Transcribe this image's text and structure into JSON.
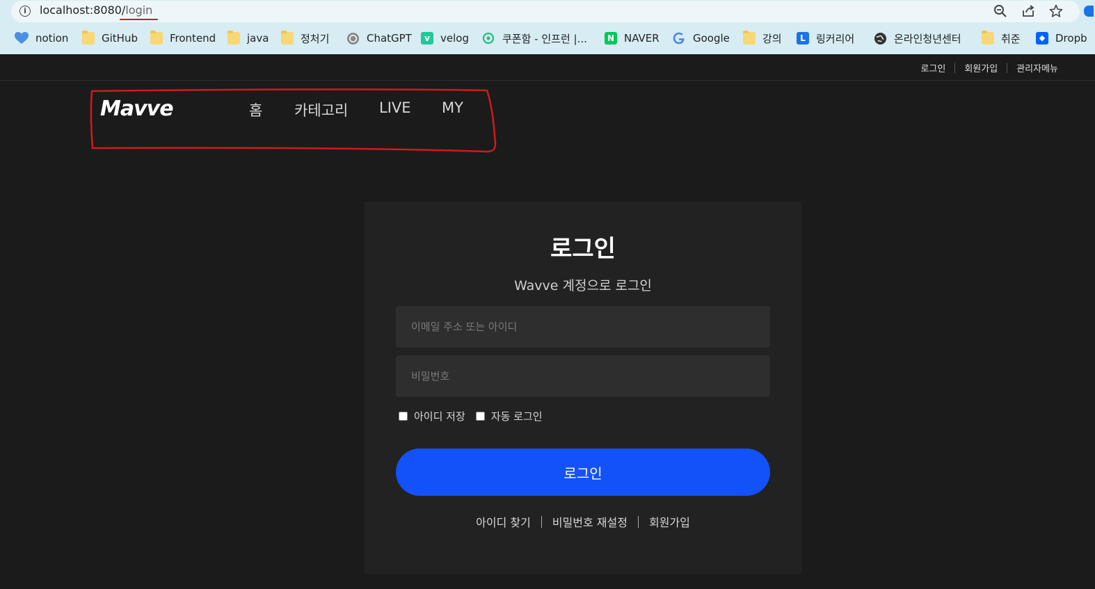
{
  "browser": {
    "url_host": "localhost:8080/",
    "url_path": "login",
    "bookmarks": [
      {
        "label": "notion",
        "icon": "heart-icon",
        "color": "#3d8fe0"
      },
      {
        "label": "GitHub",
        "icon": "folder-icon"
      },
      {
        "label": "Frontend",
        "icon": "folder-icon"
      },
      {
        "label": "java",
        "icon": "folder-icon"
      },
      {
        "label": "정처기",
        "icon": "folder-icon"
      },
      {
        "label": "ChatGPT",
        "icon": "chatgpt-icon"
      },
      {
        "label": "velog",
        "icon": "velog-icon",
        "color": "#20c997"
      },
      {
        "label": "쿠폰함 - 인프런 |...",
        "icon": "inflearn-icon",
        "color": "#1dc078"
      },
      {
        "label": "NAVER",
        "icon": "naver-icon",
        "color": "#03c75a"
      },
      {
        "label": "Google",
        "icon": "google-icon"
      },
      {
        "label": "강의",
        "icon": "folder-icon"
      },
      {
        "label": "링커리어",
        "icon": "linkareer-icon",
        "color": "#1a73e8"
      },
      {
        "label": "온라인청년센터",
        "icon": "globe-icon"
      },
      {
        "label": "취준",
        "icon": "folder-icon"
      },
      {
        "label": "Dropb",
        "icon": "dropbox-icon",
        "color": "#0061fe"
      }
    ]
  },
  "site": {
    "top_links": [
      "로그인",
      "회원가입",
      "관리자메뉴"
    ],
    "logo": "Mavve",
    "nav": [
      "홈",
      "카테고리",
      "LIVE",
      "MY"
    ]
  },
  "login": {
    "title": "로그인",
    "subtitle": "Wavve 계정으로 로그인",
    "id_placeholder": "이메일 주소 또는 아이디",
    "pw_placeholder": "비밀번호",
    "save_id": "아이디 저장",
    "auto_login": "자동 로그인",
    "button": "로그인",
    "links": [
      "아이디 찾기",
      "비밀번호 재설정",
      "회원가입"
    ]
  },
  "colors": {
    "accent": "#1351f9",
    "annotation": "#d21a1a",
    "background": "#1b1b1b",
    "card": "#222222"
  }
}
